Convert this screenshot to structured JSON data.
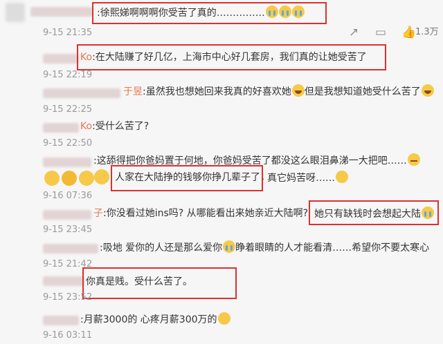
{
  "comments": [
    {
      "text": ":徐熙娣啊啊啊你受苦了真的……………",
      "time": "9-15 21:35"
    },
    {
      "name": "Ko",
      "text": ":在大陆赚了好几亿，上海市中心好几套房，我们真的让她受苦了",
      "time": "9-15 22:19"
    },
    {
      "name": "于昱",
      "text": ":虽然我也想她回来我真的好喜欢她",
      "text2": "但是我想知道她受什么苦了",
      "time": "9-15 22:25"
    },
    {
      "name": "Ko",
      "text": ":受什么苦了?",
      "time": "9-15 22:50"
    },
    {
      "text": ":这舔得把你爸妈置于何地，你爸妈受苦了都没这么眼泪鼻涕一大把吧……",
      "text2": "人家在大陆挣的钱够你挣几辈子了，",
      "text3": "真它妈苦呀……",
      "time": "9-16 07:36"
    },
    {
      "name": "子",
      "text": ":你没看过她ins吗? 从哪能看出来她亲近大陆啊?",
      "text2": "她只有缺钱时会想起大陆",
      "time": "9-15 23:45"
    },
    {
      "text": ":吸地 爱你的人还是那么爱你",
      "text2": "睁着眼睛的人才能看清……希望你不要太寒心",
      "time": "9-15 21:42"
    },
    {
      "text": "你真是贱。受什么苦了。",
      "time": "9-15 23:52"
    },
    {
      "text": ":月薪3000的 心疼月薪300万的",
      "time": "9-16 03:11"
    }
  ],
  "actions": {
    "like_count": "1.3万"
  },
  "icons": {
    "share": "share-icon",
    "comment": "comment-icon",
    "like": "like-icon"
  }
}
